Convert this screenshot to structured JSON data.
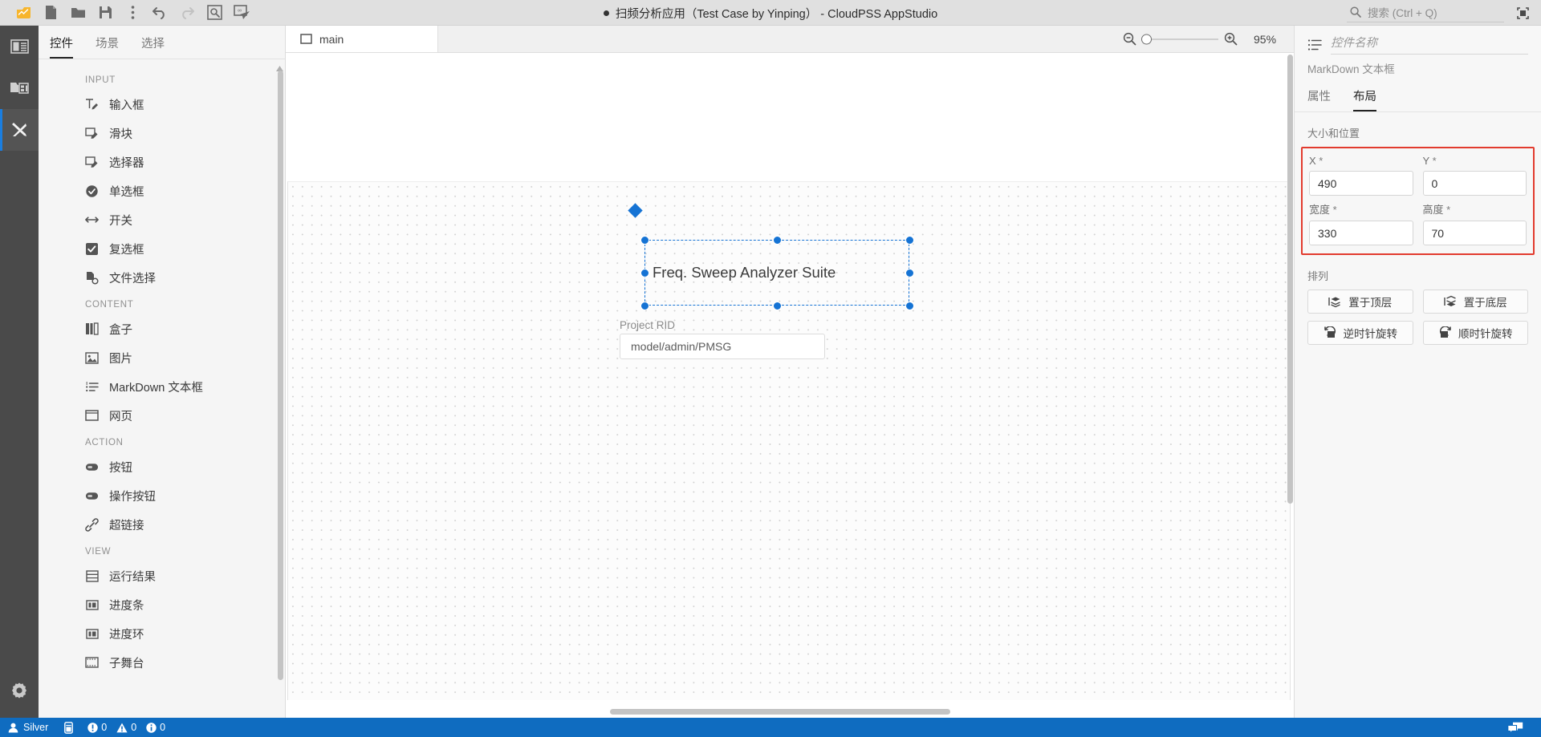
{
  "titlebar": {
    "title": "扫频分析应用（Test Case by Yinping） - CloudPSS AppStudio",
    "tools": [
      {
        "name": "app-logo-icon",
        "label": "CloudPSS"
      },
      {
        "name": "new-file-icon",
        "label": "新建"
      },
      {
        "name": "open-folder-icon",
        "label": "打开"
      },
      {
        "name": "save-icon",
        "label": "保存"
      },
      {
        "name": "more-options-icon",
        "label": "更多"
      },
      {
        "name": "undo-icon",
        "label": "撤销"
      },
      {
        "name": "redo-icon",
        "label": "重做"
      },
      {
        "name": "preview-icon",
        "label": "预览"
      },
      {
        "name": "run-icon",
        "label": "运行"
      }
    ],
    "search_placeholder": "搜索 (Ctrl + Q)",
    "window_icon": "maximize-icon"
  },
  "rail": {
    "items": [
      {
        "name": "rail-item-project",
        "icon": "layout-icon",
        "active": false
      },
      {
        "name": "rail-item-resources",
        "icon": "media-icon",
        "active": false
      },
      {
        "name": "rail-item-designer",
        "icon": "tools-icon",
        "active": true
      }
    ],
    "settings": {
      "name": "rail-item-settings",
      "icon": "gear-icon"
    }
  },
  "palette": {
    "tabs": [
      {
        "label": "控件",
        "active": true
      },
      {
        "label": "场景",
        "active": false
      },
      {
        "label": "选择",
        "active": false
      }
    ],
    "groups": [
      {
        "title": "INPUT",
        "items": [
          {
            "label": "输入框",
            "icon": "text-input-icon"
          },
          {
            "label": "滑块",
            "icon": "slider-icon"
          },
          {
            "label": "选择器",
            "icon": "select-icon"
          },
          {
            "label": "单选框",
            "icon": "radio-icon"
          },
          {
            "label": "开关",
            "icon": "switch-icon"
          },
          {
            "label": "复选框",
            "icon": "checkbox-icon"
          },
          {
            "label": "文件选择",
            "icon": "file-picker-icon"
          }
        ]
      },
      {
        "title": "CONTENT",
        "items": [
          {
            "label": "盒子",
            "icon": "box-icon"
          },
          {
            "label": "图片",
            "icon": "image-icon"
          },
          {
            "label": "MarkDown 文本框",
            "icon": "markdown-icon"
          },
          {
            "label": "网页",
            "icon": "webpage-icon"
          }
        ]
      },
      {
        "title": "ACTION",
        "items": [
          {
            "label": "按钮",
            "icon": "button-icon"
          },
          {
            "label": "操作按钮",
            "icon": "action-button-icon"
          },
          {
            "label": "超链接",
            "icon": "link-icon"
          }
        ]
      },
      {
        "title": "VIEW",
        "items": [
          {
            "label": "运行结果",
            "icon": "result-icon"
          },
          {
            "label": "进度条",
            "icon": "progress-bar-icon"
          },
          {
            "label": "进度环",
            "icon": "progress-ring-icon"
          },
          {
            "label": "子舞台",
            "icon": "substage-icon"
          }
        ]
      }
    ]
  },
  "canvas": {
    "tab": {
      "label": "main",
      "icon": "stage-icon"
    },
    "zoom": {
      "out_icon": "zoom-out-icon",
      "in_icon": "zoom-in-icon",
      "percent": "95%",
      "slider_value": 0
    },
    "selected_widget": {
      "text": "Freq. Sweep Analyzer Suite",
      "accent_color": "#1573d4"
    },
    "widgets": [
      {
        "label": "Project RID",
        "value": "model/admin/PMSG",
        "name": "project-rid-field"
      }
    ]
  },
  "inspector": {
    "name_placeholder": "控件名称",
    "name_value": "",
    "name_icon": "markdown-icon",
    "widget_type": "MarkDown 文本框",
    "tabs": [
      {
        "label": "属性",
        "active": false
      },
      {
        "label": "布局",
        "active": true
      }
    ],
    "size_position": {
      "title": "大小和位置",
      "highlight_color": "#e23b2e",
      "fields": [
        {
          "label": "X",
          "required": "*",
          "value": "490",
          "name": "x-field"
        },
        {
          "label": "Y",
          "required": "*",
          "value": "0",
          "name": "y-field"
        },
        {
          "label": "宽度",
          "required": "*",
          "value": "330",
          "name": "width-field"
        },
        {
          "label": "高度",
          "required": "*",
          "value": "70",
          "name": "height-field"
        }
      ]
    },
    "arrange": {
      "title": "排列",
      "buttons": [
        {
          "label": "置于顶层",
          "icon": "bring-to-front-icon",
          "name": "bring-to-front-button"
        },
        {
          "label": "置于底层",
          "icon": "send-to-back-icon",
          "name": "send-to-back-button"
        },
        {
          "label": "逆时针旋转",
          "icon": "rotate-ccw-icon",
          "name": "rotate-ccw-button"
        },
        {
          "label": "顺时针旋转",
          "icon": "rotate-cw-icon",
          "name": "rotate-cw-button"
        }
      ]
    }
  },
  "statusbar": {
    "user": "Silver",
    "user_icon": "user-icon",
    "device_icon": "device-icon",
    "counts": [
      {
        "icon": "error-icon",
        "value": "0"
      },
      {
        "icon": "warning-icon",
        "value": "0"
      },
      {
        "icon": "info-icon",
        "value": "0"
      }
    ],
    "feedback_icon": "feedback-icon",
    "background_color": "#0f6cc0"
  }
}
